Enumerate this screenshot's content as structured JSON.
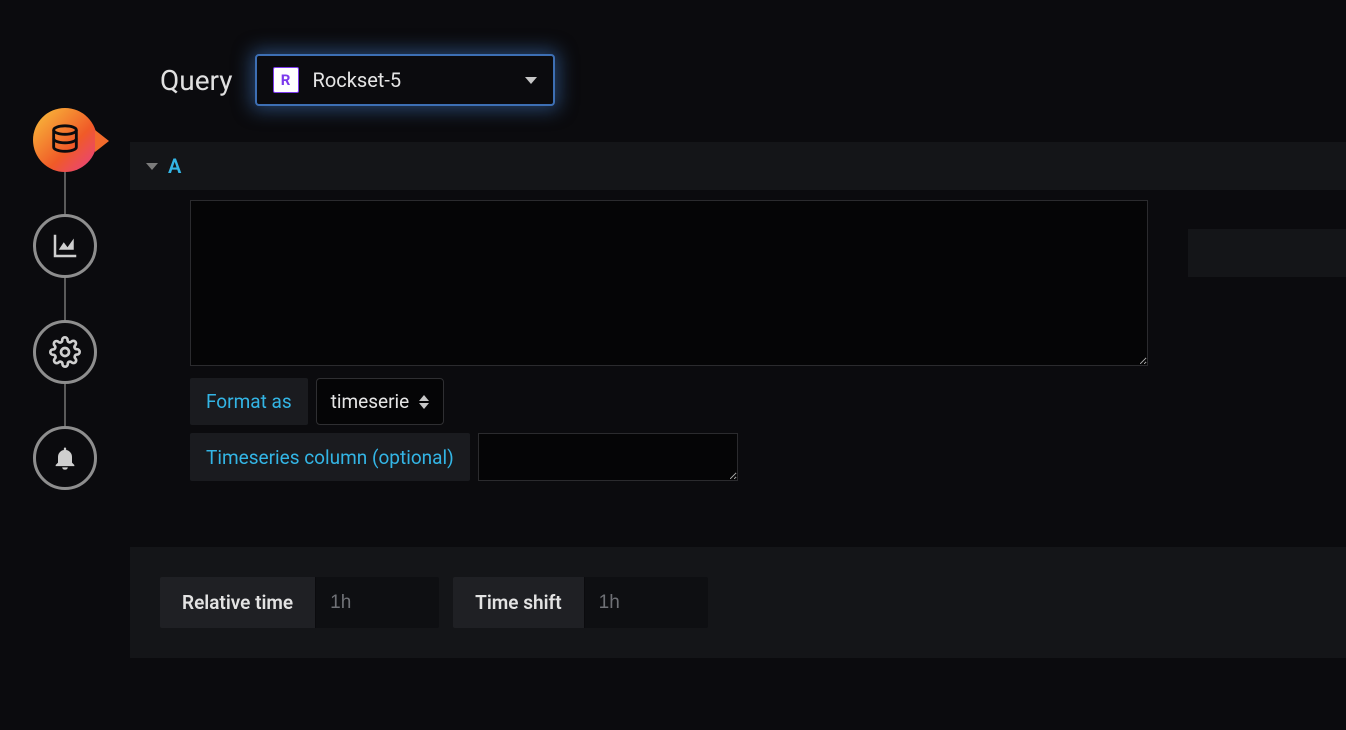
{
  "rail": {
    "items": [
      {
        "name": "datasource",
        "active": true
      },
      {
        "name": "visualization",
        "active": false
      },
      {
        "name": "settings",
        "active": false
      },
      {
        "name": "alert",
        "active": false
      }
    ]
  },
  "query": {
    "title": "Query",
    "datasource": {
      "icon_letter": "R",
      "label": "Rockset-5"
    }
  },
  "row": {
    "id": "A"
  },
  "editor": {
    "query_text": "",
    "format_as_label": "Format as",
    "format_as_value": "timeserie",
    "ts_col_label": "Timeseries column (optional)",
    "ts_col_value": ""
  },
  "time": {
    "relative_label": "Relative time",
    "relative_placeholder": "1h",
    "relative_value": "",
    "shift_label": "Time shift",
    "shift_placeholder": "1h",
    "shift_value": ""
  }
}
